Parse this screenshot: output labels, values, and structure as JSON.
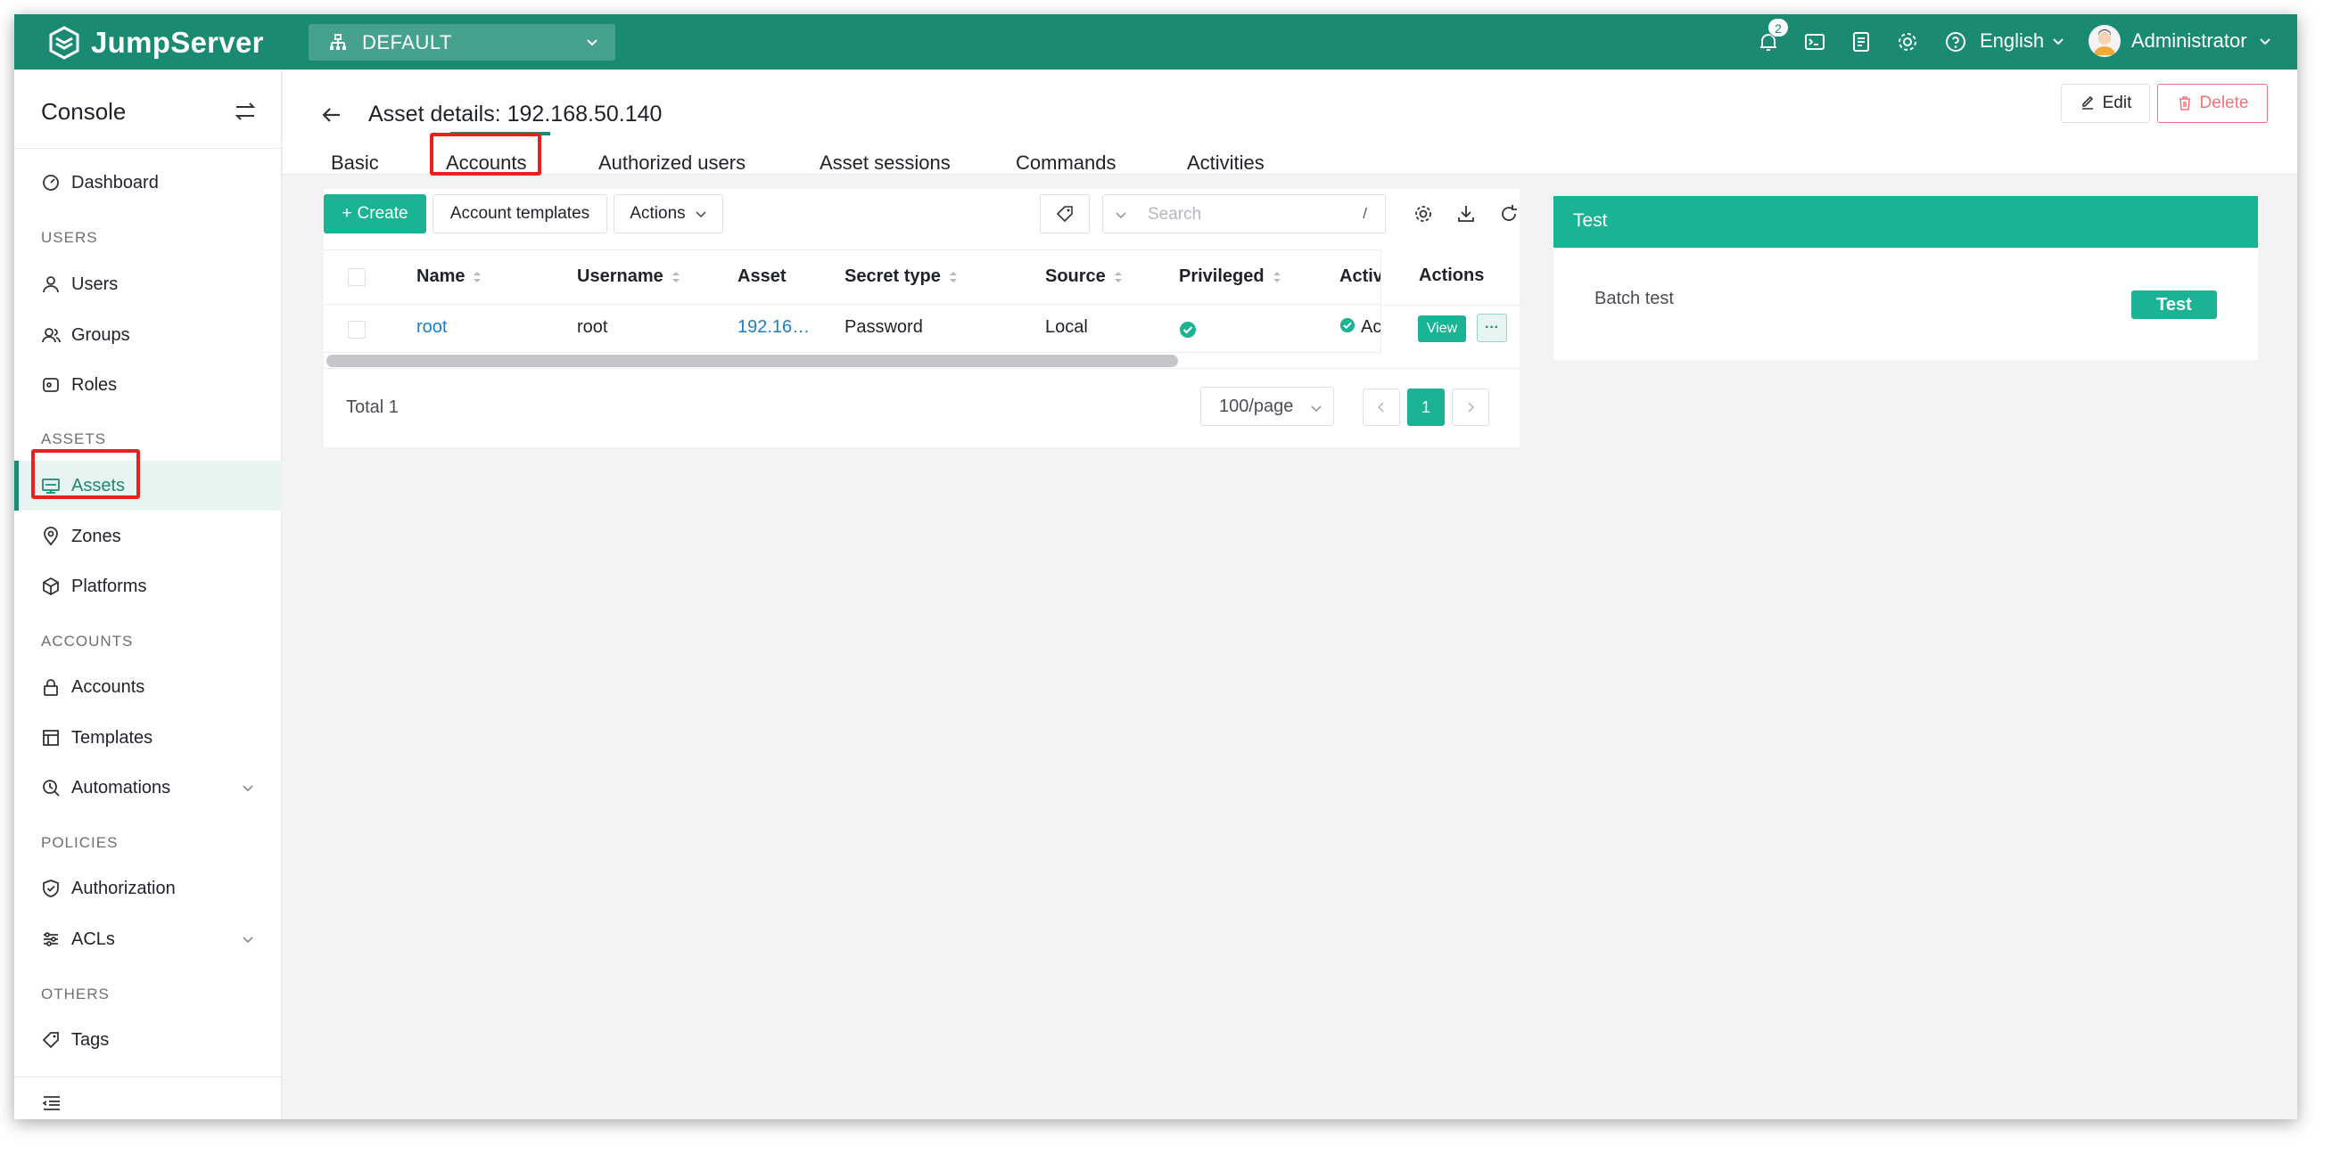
{
  "topbar": {
    "brand": "JumpServer",
    "org": "DEFAULT",
    "notification_count": "2",
    "language": "English",
    "user": "Administrator"
  },
  "sidebar": {
    "title": "Console",
    "sections": {
      "users": "USERS",
      "assets": "ASSETS",
      "accounts": "ACCOUNTS",
      "policies": "POLICIES",
      "others": "OTHERS"
    },
    "items": {
      "dashboard": "Dashboard",
      "users": "Users",
      "groups": "Groups",
      "roles": "Roles",
      "assets": "Assets",
      "zones": "Zones",
      "platforms": "Platforms",
      "accounts": "Accounts",
      "templates": "Templates",
      "automations": "Automations",
      "authorization": "Authorization",
      "acls": "ACLs",
      "tags": "Tags"
    },
    "active_item": "Assets"
  },
  "page": {
    "title": "Asset details: 192.168.50.140",
    "edit_label": "Edit",
    "delete_label": "Delete",
    "tabs": [
      "Basic",
      "Accounts",
      "Authorized users",
      "Asset sessions",
      "Commands",
      "Activities"
    ],
    "active_tab": "Accounts"
  },
  "toolbar": {
    "create_label": "Create",
    "templates_label": "Account templates",
    "actions_label": "Actions",
    "search_placeholder": "Search",
    "search_shortcut": "/"
  },
  "table": {
    "columns": [
      "Name",
      "Username",
      "Asset",
      "Secret type",
      "Source",
      "Privileged",
      "Active",
      "Actions"
    ],
    "rows": [
      {
        "name": "root",
        "username": "root",
        "asset": "192.16…",
        "secret_type": "Password",
        "source": "Local",
        "active": "Active",
        "view_label": "View",
        "more_label": "···"
      }
    ],
    "total": "Total 1",
    "page_size": "100/page",
    "current_page": "1"
  },
  "test_panel": {
    "title": "Test",
    "row_label": "Batch test",
    "button_label": "Test"
  },
  "colors": {
    "brand": "#1a8a73",
    "primary": "#1ab394",
    "danger": "#f0737b",
    "highlight": "#e8211c"
  }
}
